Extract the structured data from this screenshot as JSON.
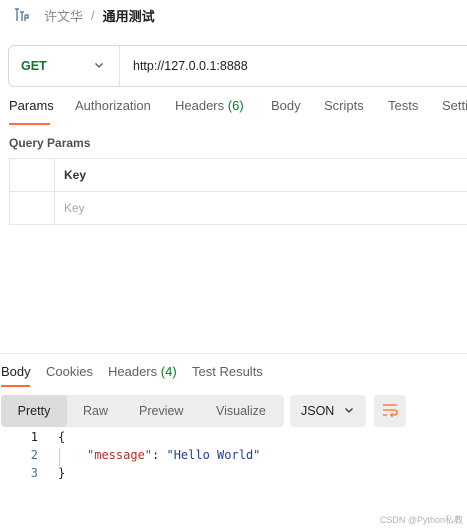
{
  "breadcrumb": {
    "icon": "http-request-icon",
    "parent": "许文华",
    "separator": "/",
    "current": "通用测试"
  },
  "request": {
    "method": "GET",
    "url": "http://127.0.0.1:8888"
  },
  "request_tabs": [
    {
      "label": "Params",
      "count": "",
      "active": true
    },
    {
      "label": "Authorization",
      "count": "",
      "active": false
    },
    {
      "label": "Headers",
      "count": "(6)",
      "active": false
    },
    {
      "label": "Body",
      "count": "",
      "active": false
    },
    {
      "label": "Scripts",
      "count": "",
      "active": false
    },
    {
      "label": "Tests",
      "count": "",
      "active": false
    },
    {
      "label": "Setti",
      "count": "",
      "active": false
    }
  ],
  "query_params": {
    "title": "Query Params",
    "column_key": "Key",
    "key_placeholder": "Key"
  },
  "response_tabs": [
    {
      "label": "Body",
      "count": "",
      "active": true
    },
    {
      "label": "Cookies",
      "count": "",
      "active": false
    },
    {
      "label": "Headers",
      "count": "(4)",
      "active": false
    },
    {
      "label": "Test Results",
      "count": "",
      "active": false
    }
  ],
  "view_modes": [
    "Pretty",
    "Raw",
    "Preview",
    "Visualize"
  ],
  "format": "JSON",
  "code": {
    "line_numbers": [
      "1",
      "2",
      "3"
    ],
    "open_brace": "{",
    "key": "\"message\"",
    "colon": ": ",
    "value": "\"Hello World\"",
    "close_brace": "}"
  },
  "watermark": "CSDN @Python私教",
  "colors": {
    "accent": "#ff6c37",
    "method_get": "#0b7a2a",
    "json_key": "#b22f22",
    "json_string": "#1f3f9c"
  }
}
